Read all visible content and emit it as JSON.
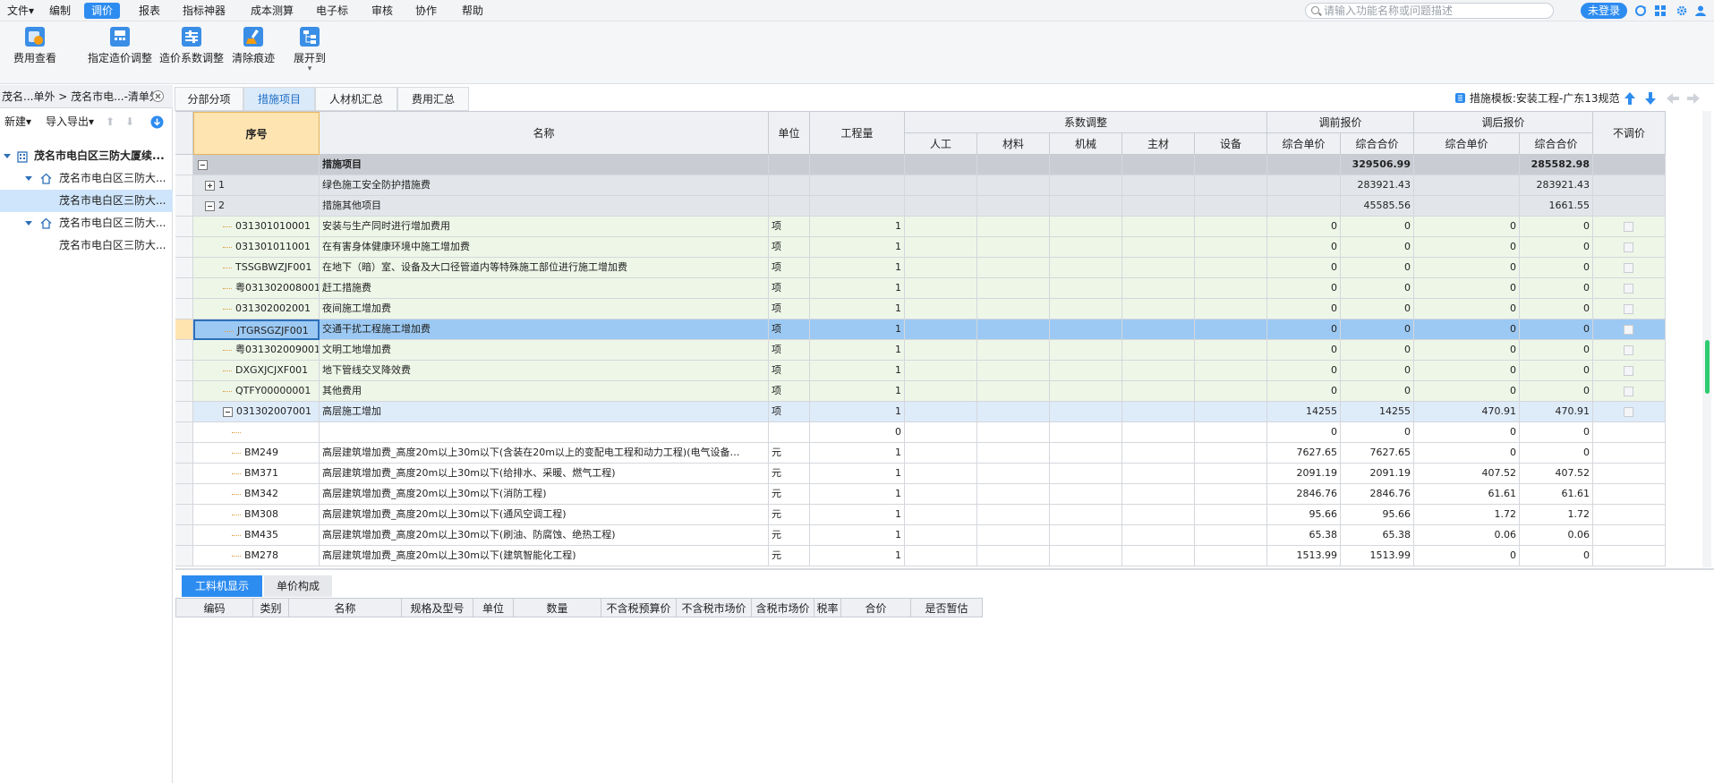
{
  "menu": {
    "items": [
      "文件",
      "编制",
      "调价",
      "报表",
      "指标神器",
      "成本测算",
      "电子标",
      "审核",
      "协作",
      "帮助"
    ],
    "active": "调价",
    "search_placeholder": "请输入功能名称或问题描述",
    "login_label": "未登录"
  },
  "toolbar": {
    "buttons": [
      "费用查看",
      "指定造价调整",
      "造价系数调整",
      "清除痕迹",
      "展开到"
    ]
  },
  "left_panel": {
    "breadcrumb": "茂名...单外 > 茂名市电...-清单外",
    "new_label": "新建",
    "import_export_label": "导入导出",
    "tree": [
      {
        "label": "茂名市电白区三防大厦续...",
        "level": 0
      },
      {
        "label": "茂名市电白区三防大...",
        "level": 1
      },
      {
        "label": "茂名市电白区三防大...",
        "level": 2
      },
      {
        "label": "茂名市电白区三防大...",
        "level": 1
      },
      {
        "label": "茂名市电白区三防大...",
        "level": 2
      }
    ]
  },
  "tabs": [
    "分部分项",
    "措施项目",
    "人材机汇总",
    "费用汇总"
  ],
  "active_tab": "措施项目",
  "template_label": "措施模板:安装工程-广东13规范",
  "grid": {
    "headers": {
      "seq": "序号",
      "name": "名称",
      "unit": "单位",
      "qty": "工程量",
      "coef_group": "系数调整",
      "labor": "人工",
      "material": "材料",
      "machine": "机械",
      "main_material": "主材",
      "equipment": "设备",
      "before_group": "调前报价",
      "after_group": "调后报价",
      "unit_price": "综合单价",
      "total_price": "综合合价",
      "no_adjust": "不调价"
    },
    "rows": [
      {
        "seq": "",
        "name": "措施项目",
        "unit": "",
        "qty": "",
        "b_up": "",
        "b_tp": "329506.99",
        "a_up": "",
        "a_tp": "285582.98",
        "type": "group"
      },
      {
        "seq": "1",
        "name": "绿色施工安全防护措施费",
        "unit": "",
        "qty": "",
        "b_up": "",
        "b_tp": "283921.43",
        "a_up": "",
        "a_tp": "283921.43",
        "type": "sub"
      },
      {
        "seq": "2",
        "name": "措施其他项目",
        "unit": "",
        "qty": "",
        "b_up": "",
        "b_tp": "45585.56",
        "a_up": "",
        "a_tp": "1661.55",
        "type": "sub"
      },
      {
        "seq": "031301010001",
        "name": "安装与生产同时进行增加费用",
        "unit": "项",
        "qty": "1",
        "b_up": "0",
        "b_tp": "0",
        "a_up": "0",
        "a_tp": "0",
        "type": "item"
      },
      {
        "seq": "031301011001",
        "name": "在有害身体健康环境中施工增加费",
        "unit": "项",
        "qty": "1",
        "b_up": "0",
        "b_tp": "0",
        "a_up": "0",
        "a_tp": "0",
        "type": "item"
      },
      {
        "seq": "TSSGBWZJF001",
        "name": "在地下（暗）室、设备及大口径管道内等特殊施工部位进行施工增加费",
        "unit": "项",
        "qty": "1",
        "b_up": "0",
        "b_tp": "0",
        "a_up": "0",
        "a_tp": "0",
        "type": "item"
      },
      {
        "seq": "粤031302008001",
        "name": "赶工措施费",
        "unit": "项",
        "qty": "1",
        "b_up": "0",
        "b_tp": "0",
        "a_up": "0",
        "a_tp": "0",
        "type": "item"
      },
      {
        "seq": "031302002001",
        "name": "夜间施工增加费",
        "unit": "项",
        "qty": "1",
        "b_up": "0",
        "b_tp": "0",
        "a_up": "0",
        "a_tp": "0",
        "type": "item"
      },
      {
        "seq": "JTGRSGZJF001",
        "name": "交通干扰工程施工增加费",
        "unit": "项",
        "qty": "1",
        "b_up": "0",
        "b_tp": "0",
        "a_up": "0",
        "a_tp": "0",
        "type": "selected"
      },
      {
        "seq": "粤031302009001",
        "name": "文明工地增加费",
        "unit": "项",
        "qty": "1",
        "b_up": "0",
        "b_tp": "0",
        "a_up": "0",
        "a_tp": "0",
        "type": "item"
      },
      {
        "seq": "DXGXJCJXF001",
        "name": "地下管线交叉降效费",
        "unit": "项",
        "qty": "1",
        "b_up": "0",
        "b_tp": "0",
        "a_up": "0",
        "a_tp": "0",
        "type": "item"
      },
      {
        "seq": "QTFY00000001",
        "name": "其他费用",
        "unit": "项",
        "qty": "1",
        "b_up": "0",
        "b_tp": "0",
        "a_up": "0",
        "a_tp": "0",
        "type": "item"
      },
      {
        "seq": "031302007001",
        "name": "高层施工增加",
        "unit": "项",
        "qty": "1",
        "b_up": "14255",
        "b_tp": "14255",
        "a_up": "470.91",
        "a_tp": "470.91",
        "type": "expanded"
      },
      {
        "seq": "",
        "name": "",
        "unit": "",
        "qty": "0",
        "b_up": "0",
        "b_tp": "0",
        "a_up": "0",
        "a_tp": "0",
        "type": "child"
      },
      {
        "seq": "BM249",
        "name": "高层建筑增加费_高度20m以上30m以下(含装在20m以上的变配电工程和动力工程)(电气设备…",
        "unit": "元",
        "qty": "1",
        "b_up": "7627.65",
        "b_tp": "7627.65",
        "a_up": "0",
        "a_tp": "0",
        "type": "child"
      },
      {
        "seq": "BM371",
        "name": "高层建筑增加费_高度20m以上30m以下(给排水、采暖、燃气工程)",
        "unit": "元",
        "qty": "1",
        "b_up": "2091.19",
        "b_tp": "2091.19",
        "a_up": "407.52",
        "a_tp": "407.52",
        "type": "child"
      },
      {
        "seq": "BM342",
        "name": "高层建筑增加费_高度20m以上30m以下(消防工程)",
        "unit": "元",
        "qty": "1",
        "b_up": "2846.76",
        "b_tp": "2846.76",
        "a_up": "61.61",
        "a_tp": "61.61",
        "type": "child"
      },
      {
        "seq": "BM308",
        "name": "高层建筑增加费_高度20m以上30m以下(通风空调工程)",
        "unit": "元",
        "qty": "1",
        "b_up": "95.66",
        "b_tp": "95.66",
        "a_up": "1.72",
        "a_tp": "1.72",
        "type": "child"
      },
      {
        "seq": "BM435",
        "name": "高层建筑增加费_高度20m以上30m以下(刷油、防腐蚀、绝热工程)",
        "unit": "元",
        "qty": "1",
        "b_up": "65.38",
        "b_tp": "65.38",
        "a_up": "0.06",
        "a_tp": "0.06",
        "type": "child"
      },
      {
        "seq": "BM278",
        "name": "高层建筑增加费_高度20m以上30m以下(建筑智能化工程)",
        "unit": "元",
        "qty": "1",
        "b_up": "1513.99",
        "b_tp": "1513.99",
        "a_up": "0",
        "a_tp": "0",
        "type": "child"
      }
    ]
  },
  "bottom": {
    "tabs": [
      "工料机显示",
      "单价构成"
    ],
    "active_tab": "工料机显示",
    "columns": [
      "编码",
      "类别",
      "名称",
      "规格及型号",
      "单位",
      "数量",
      "不含税预算价",
      "不含税市场价",
      "含税市场价",
      "税率",
      "合价",
      "是否暂估"
    ]
  },
  "colors": {
    "accent": "#2d8cf0",
    "item_row_bg": "#eef6e8",
    "group_row_bg": "#c9cdd3",
    "sub_row_bg": "#e2e5e9",
    "selected_row_bg": "#9cc9f3",
    "expanded_row_bg": "#deebf9",
    "seq_header_bg": "#fde4b0"
  }
}
